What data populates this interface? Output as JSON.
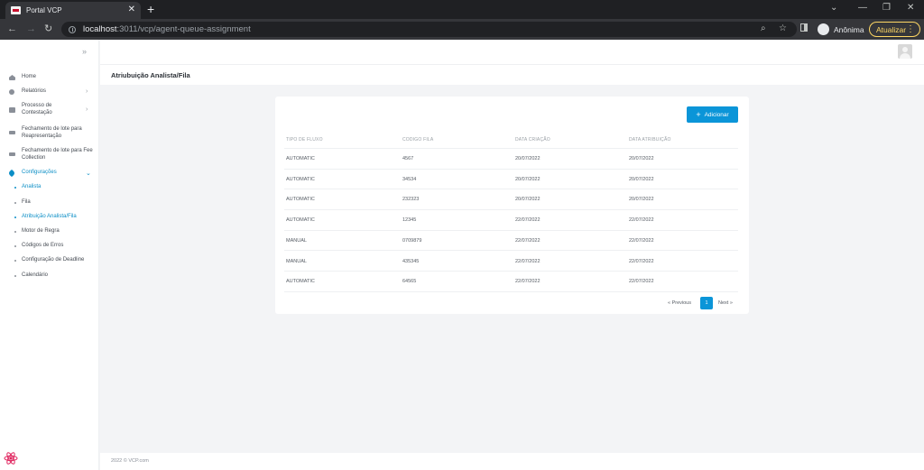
{
  "browser": {
    "tab_title": "Portal VCP",
    "url_host": "localhost",
    "url_path": ":3011/vcp/agent-queue-assignment",
    "profile_label": "Anônima",
    "update_label": "Atualizar"
  },
  "sidebar": {
    "items": [
      {
        "label": "Home",
        "icon": "home-icon"
      },
      {
        "label": "Relatórios",
        "icon": "chart-icon"
      },
      {
        "label": "Processo de Contestação",
        "icon": "folder-icon"
      },
      {
        "label": "Fechamento de lote para Reapresentação",
        "icon": "card-icon"
      },
      {
        "label": "Fechamento de lote para Fee Collection",
        "icon": "card-icon"
      },
      {
        "label": "Configurações",
        "icon": "wrench-icon"
      }
    ],
    "sub_items": [
      {
        "label": "Analista"
      },
      {
        "label": "Fila"
      },
      {
        "label": "Atribuição Analista/Fila"
      },
      {
        "label": "Motor de Regra"
      },
      {
        "label": "Códigos de Erros"
      },
      {
        "label": "Configuração de Deadline"
      },
      {
        "label": "Calendário"
      }
    ],
    "accent_color": "#0b8ec6"
  },
  "page": {
    "title": "Atriubuição Analista/Fila",
    "add_button_label": "Adicionar"
  },
  "table": {
    "headers": [
      "TIPO DE FLUXO",
      "CODIGO FILA",
      "DATA CRIAÇÃO",
      "DATA ATRIBUIÇÃO"
    ],
    "rows": [
      [
        "AUTOMATIC",
        "4567",
        "20/07/2022",
        "20/07/2022"
      ],
      [
        "AUTOMATIC",
        "34534",
        "20/07/2022",
        "20/07/2022"
      ],
      [
        "AUTOMATIC",
        "232323",
        "20/07/2022",
        "20/07/2022"
      ],
      [
        "AUTOMATIC",
        "12345",
        "22/07/2022",
        "22/07/2022"
      ],
      [
        "MANUAL",
        "0709879",
        "22/07/2022",
        "22/07/2022"
      ],
      [
        "MANUAL",
        "435345",
        "22/07/2022",
        "22/07/2022"
      ],
      [
        "AUTOMATIC",
        "64565",
        "22/07/2022",
        "22/07/2022"
      ]
    ]
  },
  "pagination": {
    "previous_label": "« Previous",
    "current_page": "1",
    "next_label": "Next »"
  },
  "footer": {
    "text": "2022 © VCP.com"
  }
}
